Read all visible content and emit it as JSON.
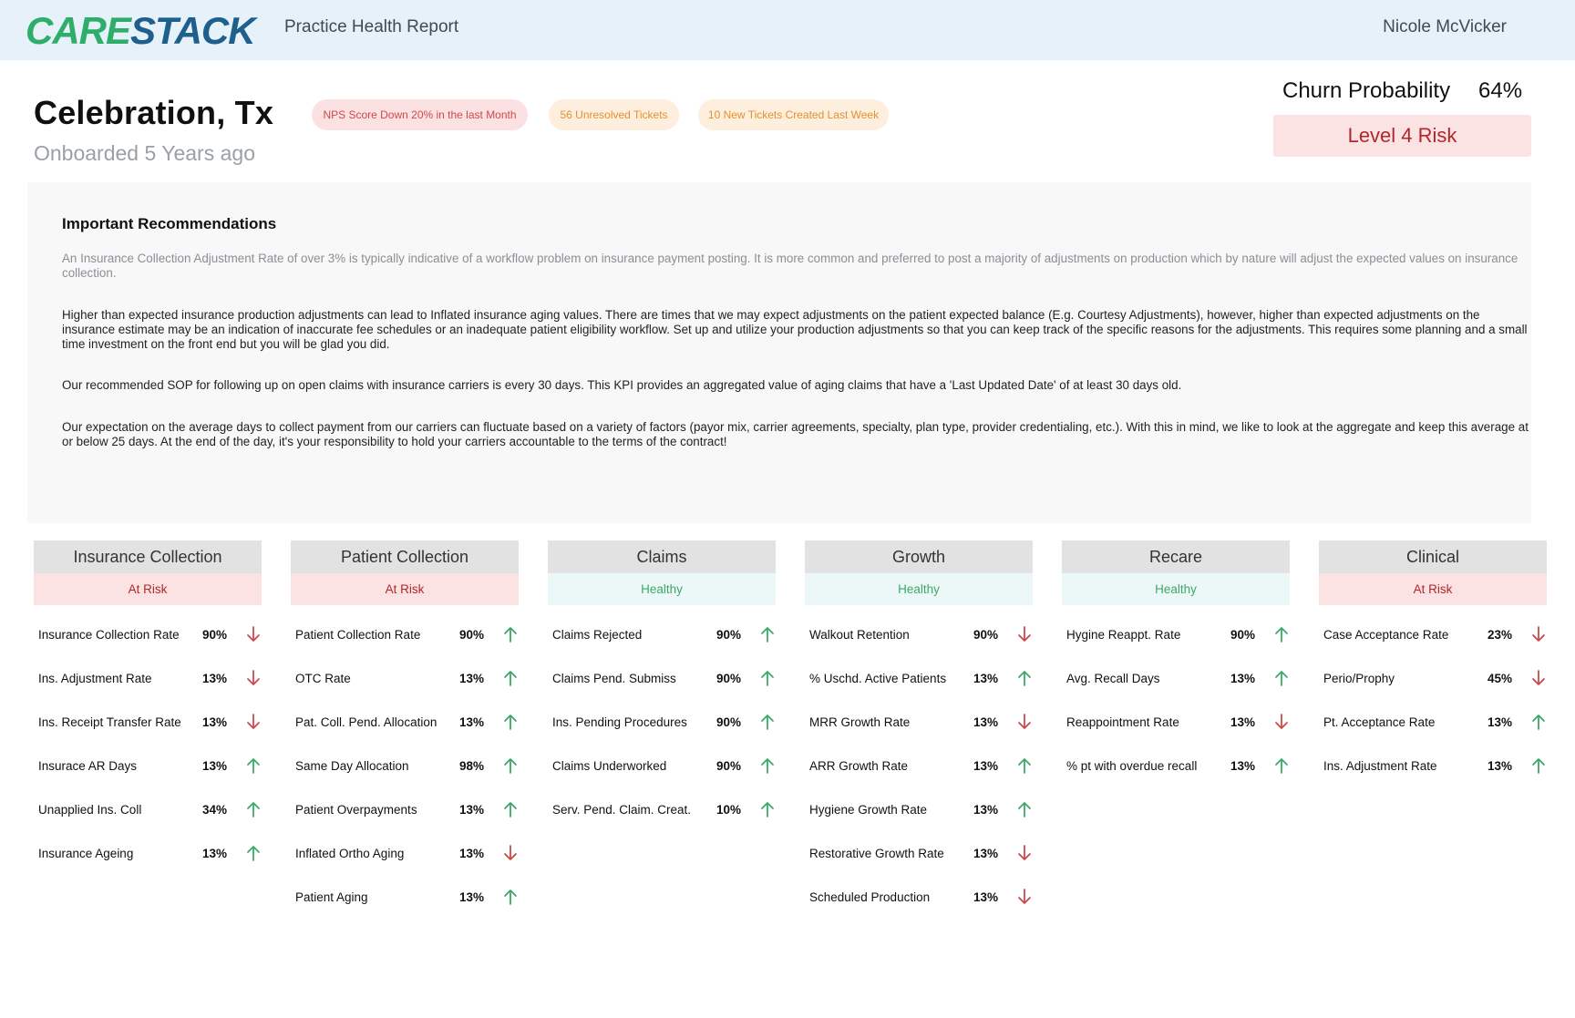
{
  "header": {
    "logo_text": "CARESTACK",
    "report_title": "Practice Health Report",
    "user_name": "Nicole McVicker"
  },
  "practice": {
    "name": "Celebration, Tx",
    "onboarded": "Onboarded 5 Years ago",
    "alerts": [
      "NPS Score Down 20% in the last Month",
      "56 Unresolved Tickets",
      "10 New Tickets Created Last Week"
    ],
    "churn_label": "Churn Probability",
    "churn_value": "64%",
    "risk_level": "Level 4 Risk"
  },
  "colors": {
    "risk_red": "#b3262a",
    "healthy_green": "#3ea868",
    "arrow_up": "#3ea868",
    "arrow_down": "#d0494a",
    "logo_green": "#2fae6b",
    "logo_blue": "#1f5f8b"
  },
  "recommendations": {
    "title": "Important Recommendations",
    "paragraphs": [
      "An Insurance Collection Adjustment Rate of over 3% is typically indicative of a workflow problem on insurance payment posting. It is more common and preferred to post a majority of adjustments on production which by nature will adjust the expected values on insurance collection.",
      "Higher than expected insurance production adjustments can lead to Inflated insurance aging values. There are times that we may expect adjustments on the patient expected balance (E.g. Courtesy Adjustments), however, higher than expected adjustments on the insurance estimate may be an indication of inaccurate fee schedules or an inadequate patient eligibility workflow. Set up and utilize your production adjustments so that you can keep track of the specific reasons for the adjustments. This requires some planning and a small time investment on the front end but you will be glad you did.",
      "Our recommended SOP for following up on open claims with insurance carriers is every 30 days. This KPI provides an aggregated value of aging claims that have a 'Last Updated Date' of at least 30 days old.",
      "Our expectation on the average days to collect payment from our carriers can fluctuate based on a variety of factors (payor mix, carrier agreements, specialty, plan type, provider credentialing, etc.). With this in mind, we like to look at the aggregate and keep this average at or below 25 days. At the end of the day, it's your responsibility to hold your carriers accountable to the terms of the contract!"
    ]
  },
  "categories": [
    {
      "name": "Insurance Collection",
      "status": "At Risk",
      "rows": [
        {
          "label": "Insurance Collection Rate",
          "value": "90%",
          "trend": "down"
        },
        {
          "label": "Ins. Adjustment Rate",
          "value": "13%",
          "trend": "down"
        },
        {
          "label": "Ins. Receipt Transfer Rate",
          "value": "13%",
          "trend": "down"
        },
        {
          "label": "Insurace AR Days",
          "value": "13%",
          "trend": "up"
        },
        {
          "label": "Unapplied Ins. Coll",
          "value": "34%",
          "trend": "up"
        },
        {
          "label": "Insurance Ageing",
          "value": "13%",
          "trend": "up"
        }
      ]
    },
    {
      "name": "Patient Collection",
      "status": "At Risk",
      "rows": [
        {
          "label": "Patient Collection Rate",
          "value": "90%",
          "trend": "up"
        },
        {
          "label": "OTC Rate",
          "value": "13%",
          "trend": "up"
        },
        {
          "label": "Pat. Coll. Pend. Allocation",
          "value": "13%",
          "trend": "up"
        },
        {
          "label": "Same Day Allocation",
          "value": "98%",
          "trend": "up"
        },
        {
          "label": "Patient Overpayments",
          "value": "13%",
          "trend": "up"
        },
        {
          "label": "Inflated Ortho Aging",
          "value": "13%",
          "trend": "down"
        },
        {
          "label": "Patient Aging",
          "value": "13%",
          "trend": "up"
        }
      ]
    },
    {
      "name": "Claims",
      "status": "Healthy",
      "rows": [
        {
          "label": "Claims Rejected",
          "value": "90%",
          "trend": "up"
        },
        {
          "label": "Claims Pend. Submiss",
          "value": "90%",
          "trend": "up"
        },
        {
          "label": "Ins. Pending Procedures",
          "value": "90%",
          "trend": "up"
        },
        {
          "label": "Claims Underworked",
          "value": "90%",
          "trend": "up"
        },
        {
          "label": "Serv. Pend. Claim. Creat.",
          "value": "10%",
          "trend": "up"
        }
      ]
    },
    {
      "name": "Growth",
      "status": "Healthy",
      "rows": [
        {
          "label": "Walkout Retention",
          "value": "90%",
          "trend": "down"
        },
        {
          "label": "% Uschd. Active Patients",
          "value": "13%",
          "trend": "up"
        },
        {
          "label": "MRR Growth Rate",
          "value": "13%",
          "trend": "down"
        },
        {
          "label": "ARR Growth Rate",
          "value": "13%",
          "trend": "up"
        },
        {
          "label": "Hygiene Growth Rate",
          "value": "13%",
          "trend": "up"
        },
        {
          "label": "Restorative Growth Rate",
          "value": "13%",
          "trend": "down"
        },
        {
          "label": "Scheduled Production",
          "value": "13%",
          "trend": "down"
        }
      ]
    },
    {
      "name": "Recare",
      "status": "Healthy",
      "rows": [
        {
          "label": "Hygine Reappt. Rate",
          "value": "90%",
          "trend": "up"
        },
        {
          "label": "Avg. Recall Days",
          "value": "13%",
          "trend": "up"
        },
        {
          "label": "Reappointment Rate",
          "value": "13%",
          "trend": "down"
        },
        {
          "label": "% pt with overdue recall",
          "value": "13%",
          "trend": "up"
        }
      ]
    },
    {
      "name": "Clinical",
      "status": "At Risk",
      "rows": [
        {
          "label": "Case Acceptance Rate",
          "value": "23%",
          "trend": "down"
        },
        {
          "label": "Perio/Prophy",
          "value": "45%",
          "trend": "down"
        },
        {
          "label": "Pt. Acceptance Rate",
          "value": "13%",
          "trend": "up"
        },
        {
          "label": "Ins. Adjustment Rate",
          "value": "13%",
          "trend": "up"
        }
      ]
    }
  ]
}
